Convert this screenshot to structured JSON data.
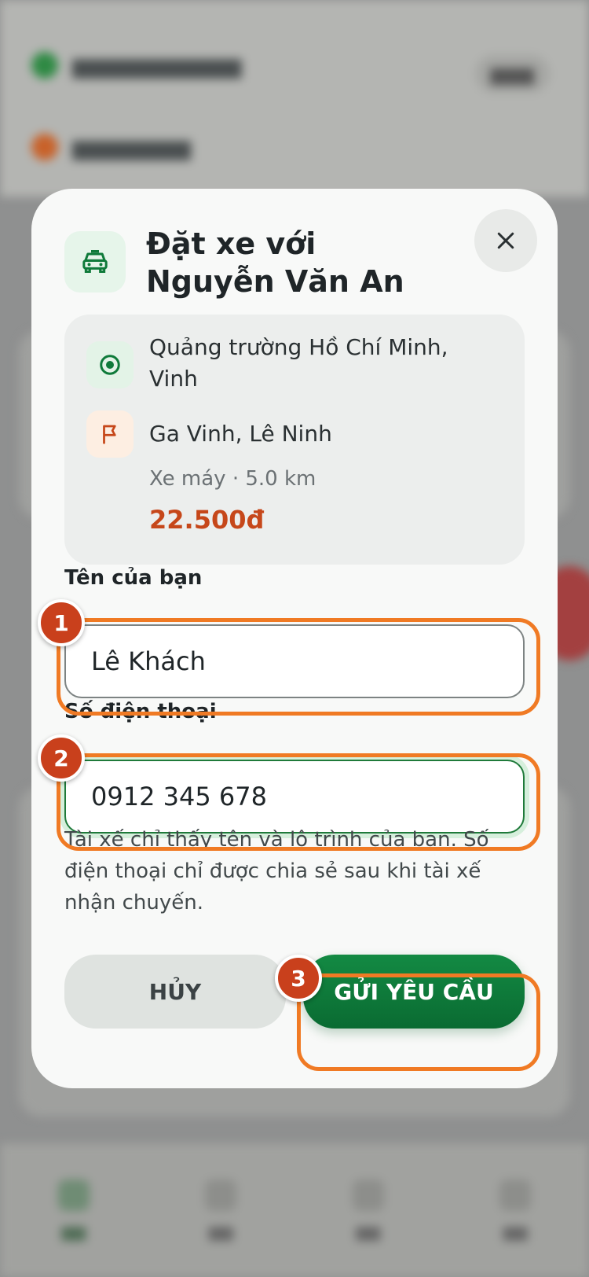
{
  "modal": {
    "title": "Đặt xe với Nguyễn Văn An",
    "title_icon": "taxi-icon",
    "close_icon": "close-icon"
  },
  "route": {
    "origin": "Quảng trường Hồ Chí Minh, Vinh",
    "destination": "Ga Vinh, Lê Ninh",
    "meta": "Xe máy · 5.0 km",
    "price": "22.500đ",
    "origin_icon": "origin-target-icon",
    "destination_icon": "destination-flag-icon"
  },
  "form": {
    "name_label": "Tên của bạn",
    "name_value": "Lê Khách",
    "phone_label": "Số điện thoại",
    "phone_value": "0912 345 678",
    "hint": "Tài xế chỉ thấy tên và lộ trình của bạn. Số điện thoại chỉ được chia sẻ sau khi tài xế nhận chuyến."
  },
  "actions": {
    "cancel_label": "HỦY",
    "submit_label": "GỬI YÊU CẦU"
  },
  "steps": [
    "1",
    "2",
    "3"
  ],
  "colors": {
    "brand_green": "#0f7a3a",
    "price_orange": "#c6471a",
    "highlight_orange": "#f07a24",
    "badge_red": "#c9401c"
  }
}
